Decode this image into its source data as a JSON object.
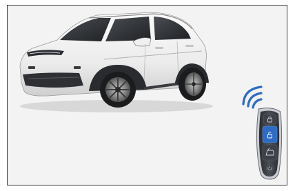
{
  "illustration": {
    "subject": "vehicle-with-smart-key-fob",
    "vehicle_color": "#f4f4f4",
    "accent_color": "#2e6bc4",
    "fob_buttons": [
      {
        "icon": "lock-icon",
        "highlighted": false
      },
      {
        "icon": "unlock-icon",
        "highlighted": true
      },
      {
        "icon": "trunk-icon",
        "highlighted": false
      },
      {
        "icon": "power-icon",
        "highlighted": false
      }
    ],
    "signal_icon": "wireless-signal-icon"
  }
}
